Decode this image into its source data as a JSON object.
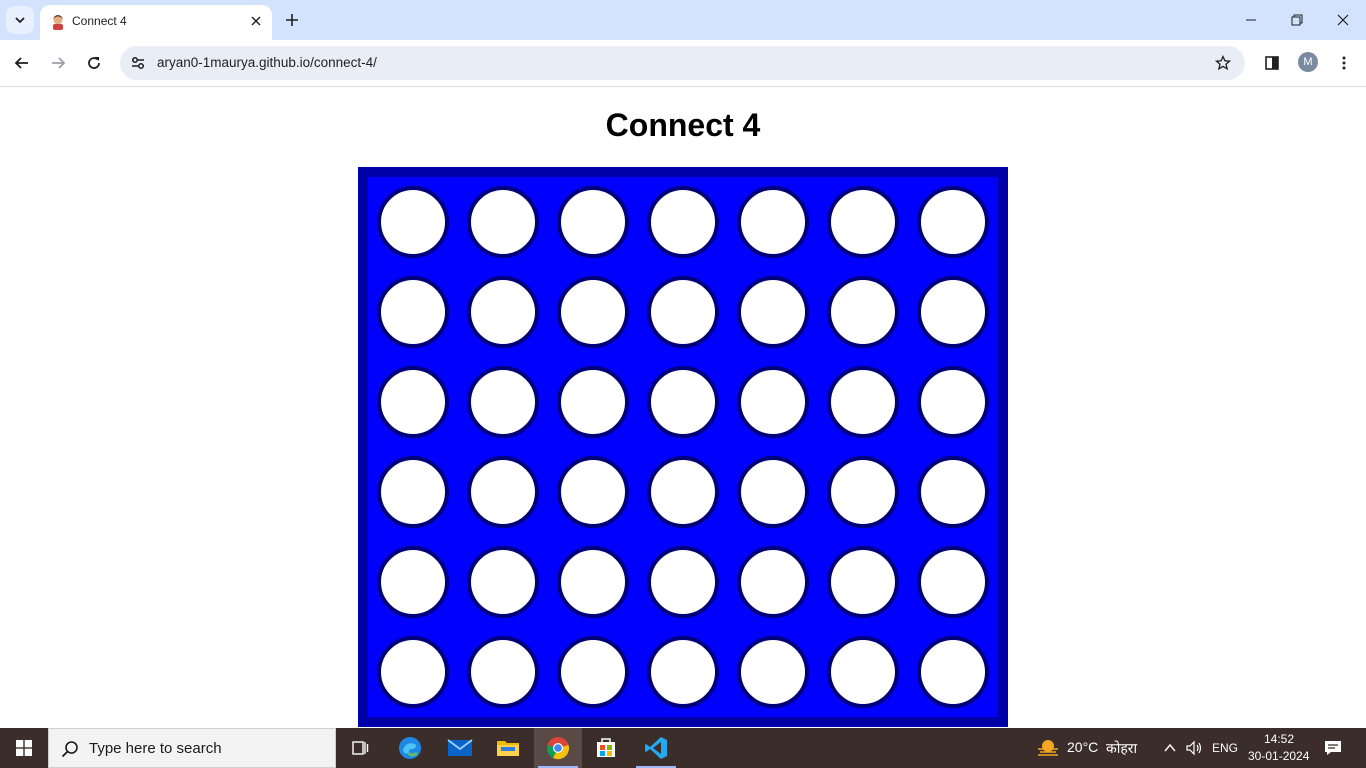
{
  "browser": {
    "tab_title": "Connect 4",
    "url": "aryan0-1maurya.github.io/connect-4/",
    "profile_initial": "M"
  },
  "page": {
    "title": "Connect 4",
    "board": {
      "rows": 6,
      "columns": 7,
      "cells": [
        [
          "empty",
          "empty",
          "empty",
          "empty",
          "empty",
          "empty",
          "empty"
        ],
        [
          "empty",
          "empty",
          "empty",
          "empty",
          "empty",
          "empty",
          "empty"
        ],
        [
          "empty",
          "empty",
          "empty",
          "empty",
          "empty",
          "empty",
          "empty"
        ],
        [
          "empty",
          "empty",
          "empty",
          "empty",
          "empty",
          "empty",
          "empty"
        ],
        [
          "empty",
          "empty",
          "empty",
          "empty",
          "empty",
          "empty",
          "empty"
        ],
        [
          "empty",
          "empty",
          "empty",
          "empty",
          "empty",
          "empty",
          "empty"
        ]
      ]
    }
  },
  "taskbar": {
    "search_placeholder": "Type here to search",
    "weather_temp": "20°C",
    "weather_desc": "कोहरा",
    "language": "ENG",
    "time": "14:52",
    "date": "30-01-2024",
    "apps": [
      "task-view",
      "edge",
      "mail",
      "file-explorer",
      "chrome",
      "microsoft-store",
      "vscode"
    ]
  },
  "colors": {
    "board_frame": "#0000a8",
    "board_fill": "#0000ff",
    "hole": "#ffffff",
    "hole_border": "#00007a"
  }
}
